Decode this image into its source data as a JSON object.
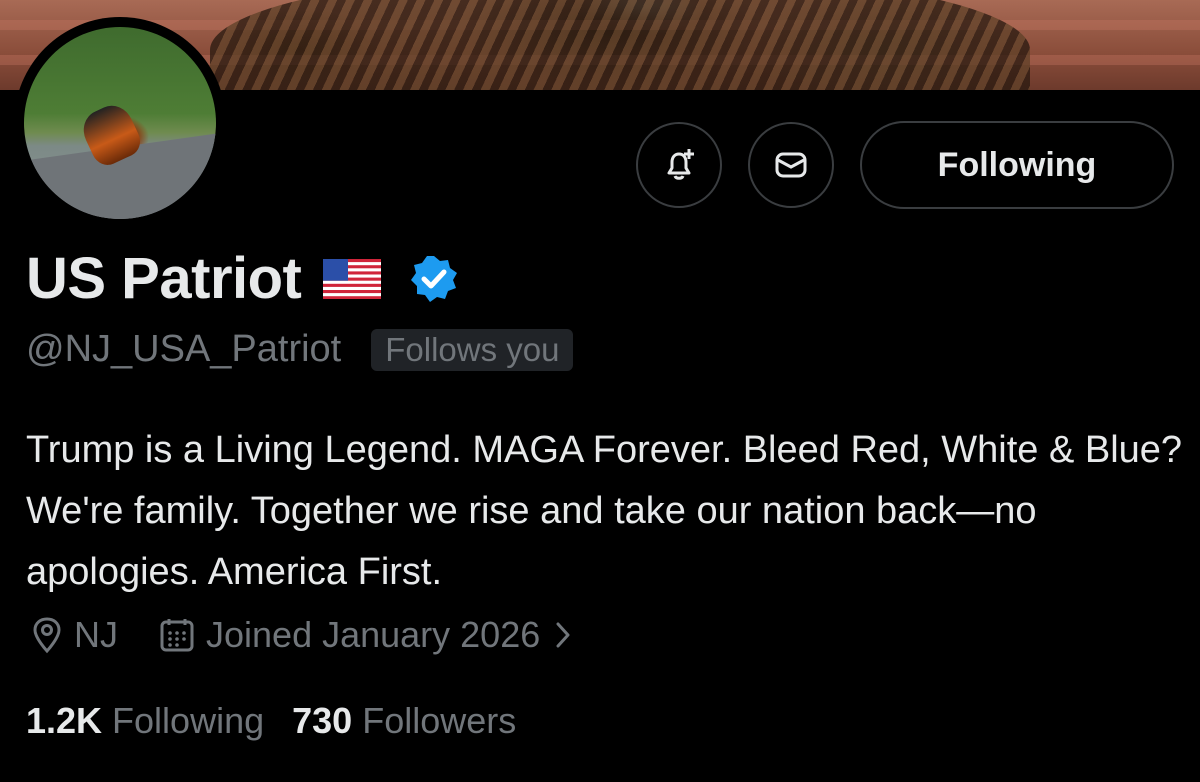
{
  "profile": {
    "display_name": "US Patriot",
    "handle": "@NJ_USA_Patriot",
    "follows_you": "Follows you",
    "bio": "Trump is a Living Legend. MAGA Forever. Bleed Red, White & Blue? We're family. Together we rise and take our nation back—no apologies. America First.",
    "location": "NJ",
    "joined": "Joined January 2026",
    "verified_badge_color": "#1d9bf0",
    "flag_emoji": "us-flag-icon"
  },
  "actions": {
    "follow_label": "Following",
    "notify_icon": "bell-plus-icon",
    "message_icon": "envelope-icon"
  },
  "stats": {
    "following_count": "1.2K",
    "following_label": "Following",
    "followers_count": "730",
    "followers_label": "Followers"
  }
}
